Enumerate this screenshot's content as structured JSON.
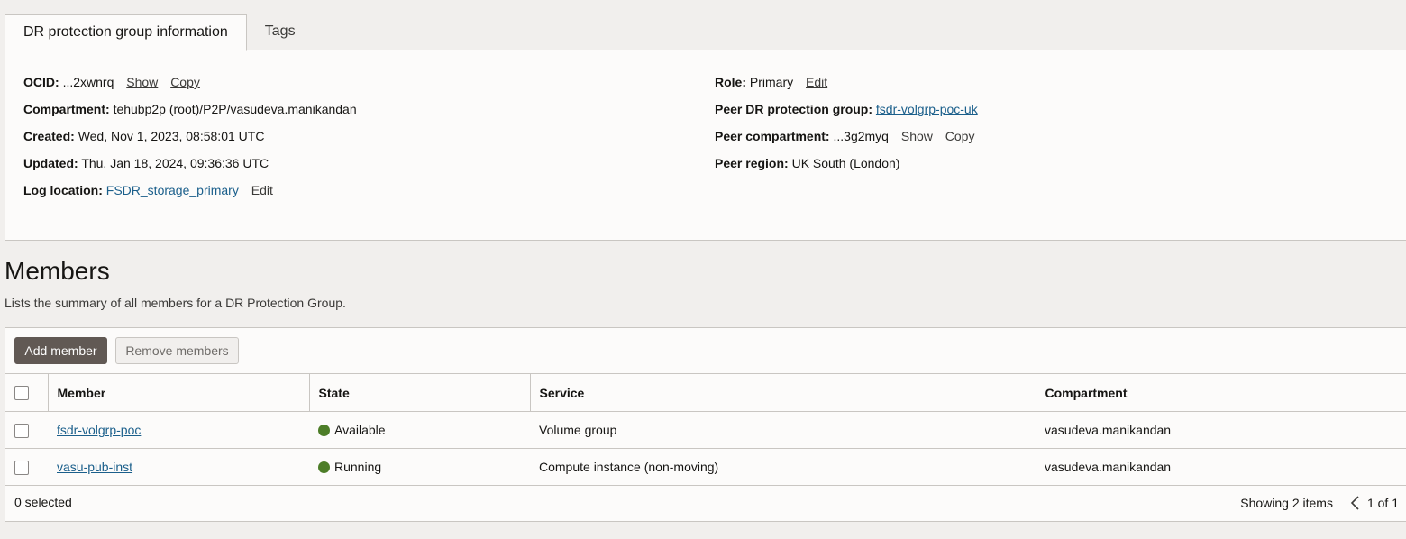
{
  "tabs": [
    {
      "label": "DR protection group information",
      "active": true
    },
    {
      "label": "Tags",
      "active": false
    }
  ],
  "info": {
    "ocid": {
      "label": "OCID:",
      "value": "...2xwnrq",
      "show": "Show",
      "copy": "Copy"
    },
    "compartment": {
      "label": "Compartment:",
      "value": "tehubp2p (root)/P2P/vasudeva.manikandan"
    },
    "created": {
      "label": "Created:",
      "value": "Wed, Nov 1, 2023, 08:58:01 UTC"
    },
    "updated": {
      "label": "Updated:",
      "value": "Thu, Jan 18, 2024, 09:36:36 UTC"
    },
    "log_location": {
      "label": "Log location:",
      "value": "FSDR_storage_primary",
      "edit": "Edit"
    },
    "role": {
      "label": "Role:",
      "value": "Primary",
      "edit": "Edit"
    },
    "peer_group": {
      "label": "Peer DR protection group:",
      "value": "fsdr-volgrp-poc-uk"
    },
    "peer_compartment": {
      "label": "Peer compartment:",
      "value": "...3g2myq",
      "show": "Show",
      "copy": "Copy"
    },
    "peer_region": {
      "label": "Peer region:",
      "value": "UK South (London)"
    }
  },
  "members": {
    "title": "Members",
    "description": "Lists the summary of all members for a DR Protection Group.",
    "add_button": "Add member",
    "remove_button": "Remove members",
    "columns": [
      "Member",
      "State",
      "Service",
      "Compartment"
    ],
    "rows": [
      {
        "member": "fsdr-volgrp-poc",
        "state": "Available",
        "state_color": "#4d7d28",
        "service": "Volume group",
        "compartment": "vasudeva.manikandan"
      },
      {
        "member": "vasu-pub-inst",
        "state": "Running",
        "state_color": "#4d7d28",
        "service": "Compute instance (non-moving)",
        "compartment": "vasudeva.manikandan"
      }
    ],
    "selected_text": "0 selected",
    "showing_text": "Showing 2 items",
    "page_text": "1 of 1"
  }
}
